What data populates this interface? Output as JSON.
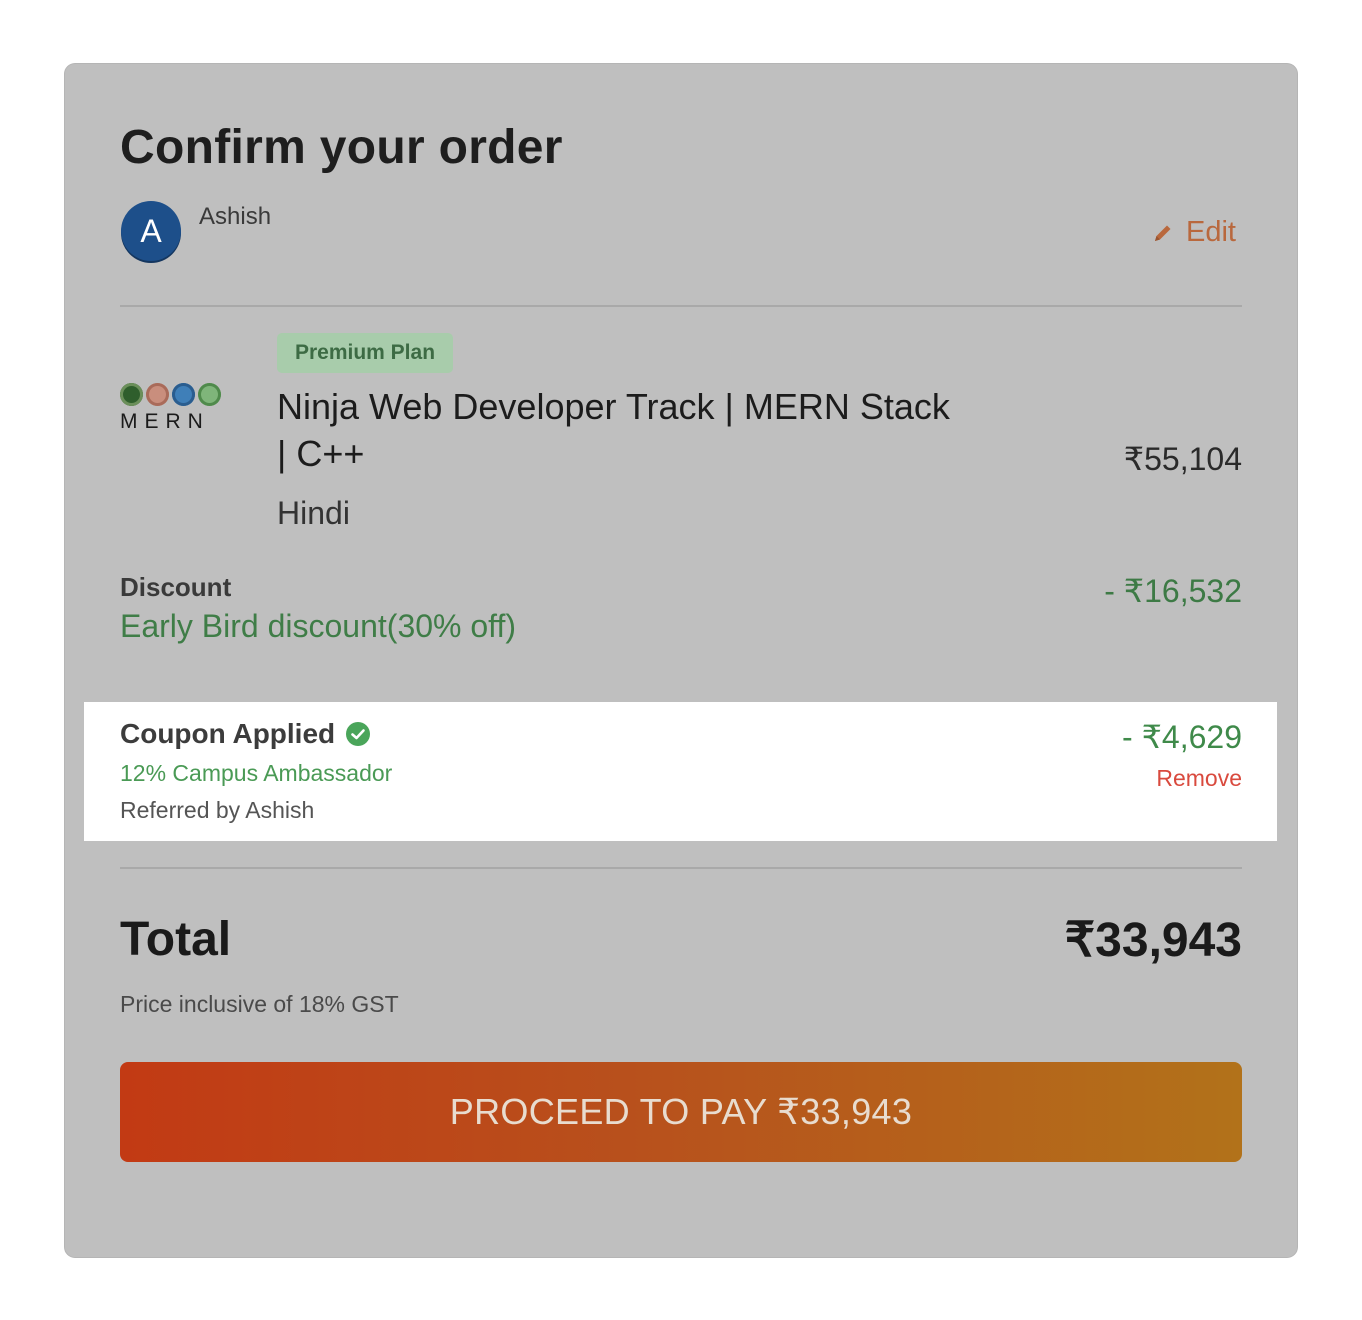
{
  "header": {
    "title": "Confirm your order"
  },
  "user": {
    "avatar_letter": "A",
    "name": "Ashish",
    "edit_label": "Edit"
  },
  "course": {
    "badge": "Premium Plan",
    "logo_text": "MERN",
    "title": "Ninja Web Developer Track | MERN Stack | C++",
    "language": "Hindi",
    "price": "₹55,104"
  },
  "discount": {
    "label": "Discount",
    "description": "Early Bird discount(30% off)",
    "amount": "- ₹16,532"
  },
  "coupon": {
    "label": "Coupon Applied",
    "description": "12% Campus Ambassador",
    "referred_by": "Referred by Ashish",
    "amount": "- ₹4,629",
    "remove_label": "Remove"
  },
  "total": {
    "label": "Total",
    "amount": "₹33,943",
    "gst_note": "Price inclusive of 18% GST"
  },
  "pay_button": {
    "label": "PROCEED TO PAY ₹33,943"
  },
  "colors": {
    "accent_orange": "#c23a14",
    "discount_green": "#3f7d47",
    "remove_red": "#d94a3e",
    "avatar_blue": "#1d4f8a"
  },
  "icons": {
    "edit": "pencil-icon",
    "coupon_verified": "check-circle-icon"
  }
}
